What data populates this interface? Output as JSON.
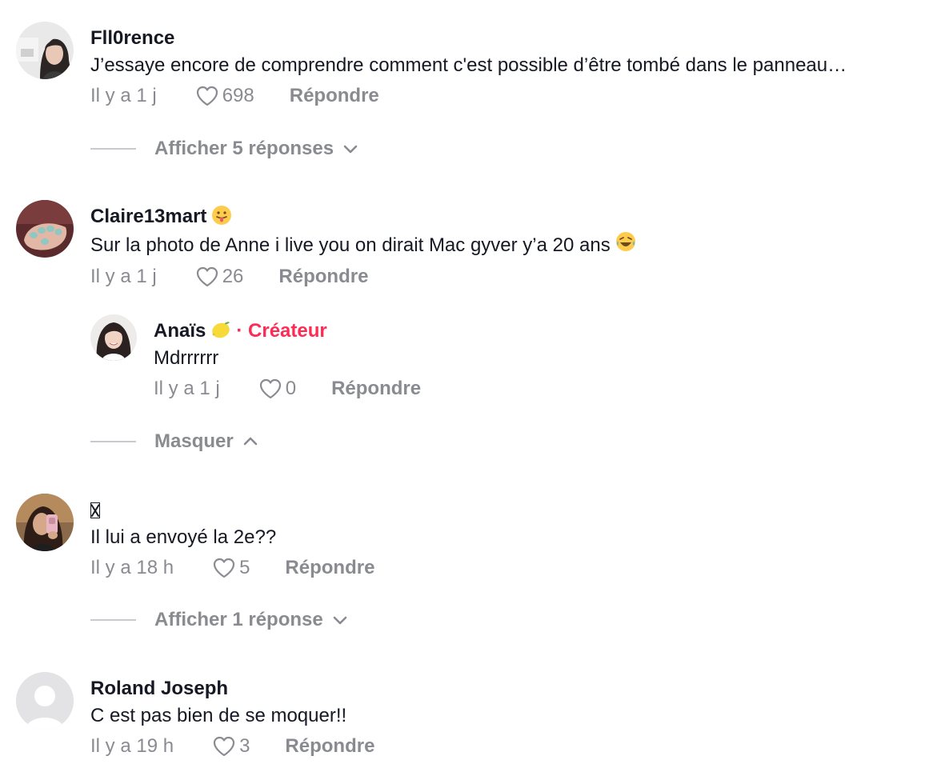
{
  "comments": [
    {
      "username": "Fll0rence",
      "text": "J’essaye encore de comprendre comment c'est possible d’être tombé dans le panneau…",
      "time": "Il y a 1 j",
      "likes": "698",
      "reply_label": "Répondre",
      "avatar_icon": "avatar-woman-dark-hair"
    },
    {
      "username": "Claire13mart",
      "username_emoji": "tongue-out-emoji",
      "text": "Sur la photo de Anne i live you on dirait Mac gyver y’a 20 ans",
      "text_emoji": "laughing-tears-emoji",
      "time": "Il y a 1 j",
      "likes": "26",
      "reply_label": "Répondre",
      "avatar_icon": "avatar-painted-nails"
    },
    {
      "username": "",
      "username_glyph": "missing-glyph",
      "text": "Il lui a envoyé la 2e??",
      "time": "Il y a 18 h",
      "likes": "5",
      "reply_label": "Répondre",
      "avatar_icon": "avatar-woman-selfie"
    },
    {
      "username": "Roland Joseph",
      "text": "C est pas bien de se moquer!!",
      "time": "Il y a 19 h",
      "likes": "3",
      "reply_label": "Répondre",
      "avatar_icon": "avatar-default-user"
    }
  ],
  "replies": [
    {
      "username": "Anaïs",
      "username_emoji": "lemon-emoji",
      "creator_label": "· Créateur",
      "text": "Mdrrrrrr",
      "time": "Il y a 1 j",
      "likes": "0",
      "reply_label": "Répondre",
      "avatar_icon": "avatar-woman-smiling"
    }
  ],
  "toggles": {
    "show_replies_1": "Afficher 5 réponses",
    "hide_replies": "Masquer",
    "show_replies_2": "Afficher 1 réponse"
  },
  "colors": {
    "text": "#161823",
    "muted": "#8a8b91",
    "creator": "#fe2c55",
    "divider": "#c9cacf"
  }
}
